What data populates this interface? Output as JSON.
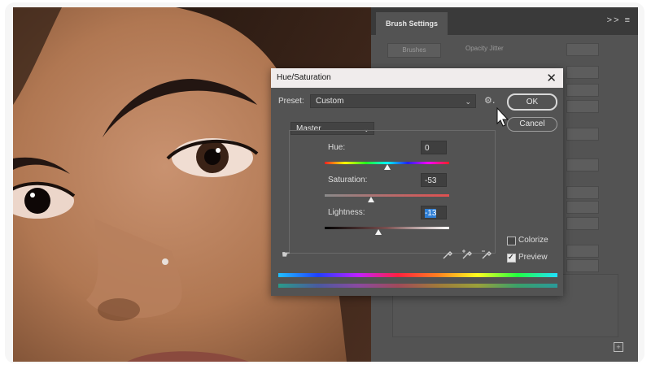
{
  "brush_settings": {
    "tab": "Brush Settings",
    "menu": ">> ≡",
    "brushes_button": "Brushes",
    "opacity_jitter_label": "Opacity Jitter",
    "footer_icon": "add-icon"
  },
  "dialog": {
    "title": "Hue/Saturation",
    "close": "✕",
    "preset_label": "Preset:",
    "preset_value": "Custom",
    "ok": "OK",
    "cancel": "Cancel",
    "channel": "Master",
    "hue": {
      "label": "Hue:",
      "value": "0",
      "level": 0.5
    },
    "saturation": {
      "label": "Saturation:",
      "value": "-53",
      "level": 0.37
    },
    "lightness": {
      "label": "Lightness:",
      "value": "-13",
      "level": 0.43
    },
    "colorize_label": "Colorize",
    "colorize_checked": false,
    "preview_label": "Preview",
    "preview_checked": true
  },
  "icons": [
    "gear-icon",
    "targeted-adjustment-hand-icon",
    "eyedropper-icon",
    "eyedropper-plus-icon",
    "eyedropper-minus-icon"
  ],
  "colors": {
    "dialog_bg": "#535353",
    "title_bg": "#f0ecec",
    "selection": "#2f7fd6"
  }
}
